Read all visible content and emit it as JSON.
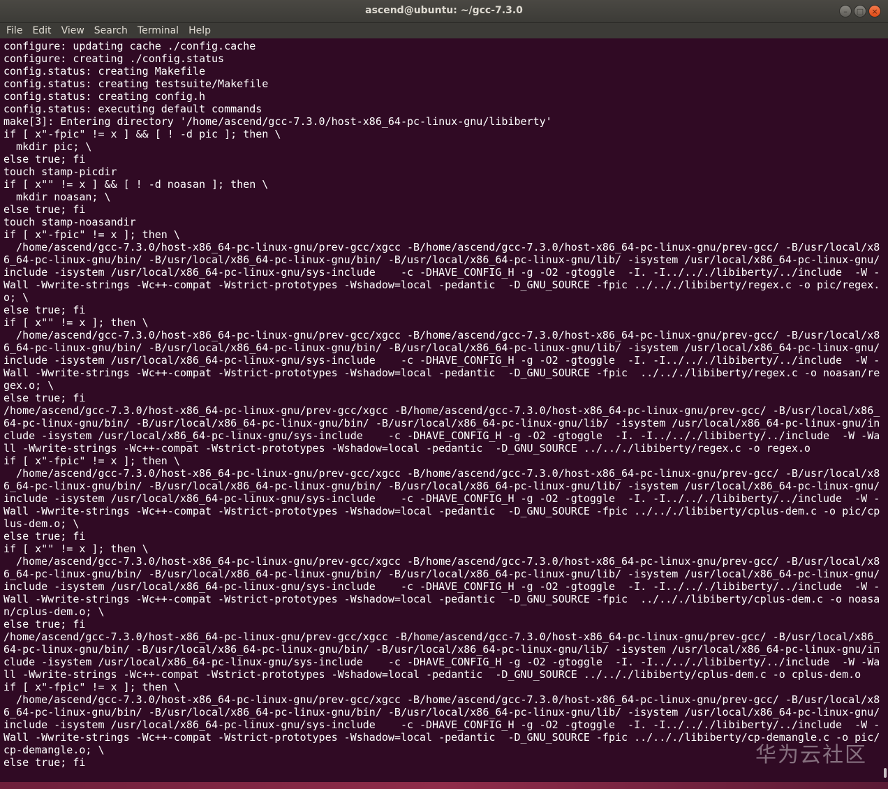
{
  "window": {
    "title": "ascend@ubuntu: ~/gcc-7.3.0",
    "minimize_glyph": "–",
    "maximize_glyph": "□",
    "close_glyph": "×"
  },
  "menubar": {
    "items": [
      "File",
      "Edit",
      "View",
      "Search",
      "Terminal",
      "Help"
    ]
  },
  "terminal": {
    "background": "#300a24",
    "foreground": "#ffffff",
    "output": "configure: updating cache ./config.cache\nconfigure: creating ./config.status\nconfig.status: creating Makefile\nconfig.status: creating testsuite/Makefile\nconfig.status: creating config.h\nconfig.status: executing default commands\nmake[3]: Entering directory '/home/ascend/gcc-7.3.0/host-x86_64-pc-linux-gnu/libiberty'\nif [ x\"-fpic\" != x ] && [ ! -d pic ]; then \\\n  mkdir pic; \\\nelse true; fi\ntouch stamp-picdir\nif [ x\"\" != x ] && [ ! -d noasan ]; then \\\n  mkdir noasan; \\\nelse true; fi\ntouch stamp-noasandir\nif [ x\"-fpic\" != x ]; then \\\n  /home/ascend/gcc-7.3.0/host-x86_64-pc-linux-gnu/prev-gcc/xgcc -B/home/ascend/gcc-7.3.0/host-x86_64-pc-linux-gnu/prev-gcc/ -B/usr/local/x8\n6_64-pc-linux-gnu/bin/ -B/usr/local/x86_64-pc-linux-gnu/bin/ -B/usr/local/x86_64-pc-linux-gnu/lib/ -isystem /usr/local/x86_64-pc-linux-gnu/\ninclude -isystem /usr/local/x86_64-pc-linux-gnu/sys-include    -c -DHAVE_CONFIG_H -g -O2 -gtoggle  -I. -I../.././libiberty/../include  -W -\nWall -Wwrite-strings -Wc++-compat -Wstrict-prototypes -Wshadow=local -pedantic  -D_GNU_SOURCE -fpic ../.././libiberty/regex.c -o pic/regex.\no; \\\nelse true; fi\nif [ x\"\" != x ]; then \\\n  /home/ascend/gcc-7.3.0/host-x86_64-pc-linux-gnu/prev-gcc/xgcc -B/home/ascend/gcc-7.3.0/host-x86_64-pc-linux-gnu/prev-gcc/ -B/usr/local/x8\n6_64-pc-linux-gnu/bin/ -B/usr/local/x86_64-pc-linux-gnu/bin/ -B/usr/local/x86_64-pc-linux-gnu/lib/ -isystem /usr/local/x86_64-pc-linux-gnu/\ninclude -isystem /usr/local/x86_64-pc-linux-gnu/sys-include    -c -DHAVE_CONFIG_H -g -O2 -gtoggle  -I. -I../.././libiberty/../include  -W -\nWall -Wwrite-strings -Wc++-compat -Wstrict-prototypes -Wshadow=local -pedantic  -D_GNU_SOURCE -fpic  ../.././libiberty/regex.c -o noasan/re\ngex.o; \\\nelse true; fi\n/home/ascend/gcc-7.3.0/host-x86_64-pc-linux-gnu/prev-gcc/xgcc -B/home/ascend/gcc-7.3.0/host-x86_64-pc-linux-gnu/prev-gcc/ -B/usr/local/x86_\n64-pc-linux-gnu/bin/ -B/usr/local/x86_64-pc-linux-gnu/bin/ -B/usr/local/x86_64-pc-linux-gnu/lib/ -isystem /usr/local/x86_64-pc-linux-gnu/in\nclude -isystem /usr/local/x86_64-pc-linux-gnu/sys-include    -c -DHAVE_CONFIG_H -g -O2 -gtoggle  -I. -I../.././libiberty/../include  -W -Wa\nll -Wwrite-strings -Wc++-compat -Wstrict-prototypes -Wshadow=local -pedantic  -D_GNU_SOURCE ../.././libiberty/regex.c -o regex.o\nif [ x\"-fpic\" != x ]; then \\\n  /home/ascend/gcc-7.3.0/host-x86_64-pc-linux-gnu/prev-gcc/xgcc -B/home/ascend/gcc-7.3.0/host-x86_64-pc-linux-gnu/prev-gcc/ -B/usr/local/x8\n6_64-pc-linux-gnu/bin/ -B/usr/local/x86_64-pc-linux-gnu/bin/ -B/usr/local/x86_64-pc-linux-gnu/lib/ -isystem /usr/local/x86_64-pc-linux-gnu/\ninclude -isystem /usr/local/x86_64-pc-linux-gnu/sys-include    -c -DHAVE_CONFIG_H -g -O2 -gtoggle  -I. -I../.././libiberty/../include  -W -\nWall -Wwrite-strings -Wc++-compat -Wstrict-prototypes -Wshadow=local -pedantic  -D_GNU_SOURCE -fpic ../.././libiberty/cplus-dem.c -o pic/cp\nlus-dem.o; \\\nelse true; fi\nif [ x\"\" != x ]; then \\\n  /home/ascend/gcc-7.3.0/host-x86_64-pc-linux-gnu/prev-gcc/xgcc -B/home/ascend/gcc-7.3.0/host-x86_64-pc-linux-gnu/prev-gcc/ -B/usr/local/x8\n6_64-pc-linux-gnu/bin/ -B/usr/local/x86_64-pc-linux-gnu/bin/ -B/usr/local/x86_64-pc-linux-gnu/lib/ -isystem /usr/local/x86_64-pc-linux-gnu/\ninclude -isystem /usr/local/x86_64-pc-linux-gnu/sys-include    -c -DHAVE_CONFIG_H -g -O2 -gtoggle  -I. -I../.././libiberty/../include  -W -\nWall -Wwrite-strings -Wc++-compat -Wstrict-prototypes -Wshadow=local -pedantic  -D_GNU_SOURCE -fpic  ../.././libiberty/cplus-dem.c -o noasa\nn/cplus-dem.o; \\\nelse true; fi\n/home/ascend/gcc-7.3.0/host-x86_64-pc-linux-gnu/prev-gcc/xgcc -B/home/ascend/gcc-7.3.0/host-x86_64-pc-linux-gnu/prev-gcc/ -B/usr/local/x86_\n64-pc-linux-gnu/bin/ -B/usr/local/x86_64-pc-linux-gnu/bin/ -B/usr/local/x86_64-pc-linux-gnu/lib/ -isystem /usr/local/x86_64-pc-linux-gnu/in\nclude -isystem /usr/local/x86_64-pc-linux-gnu/sys-include    -c -DHAVE_CONFIG_H -g -O2 -gtoggle  -I. -I../.././libiberty/../include  -W -Wa\nll -Wwrite-strings -Wc++-compat -Wstrict-prototypes -Wshadow=local -pedantic  -D_GNU_SOURCE ../.././libiberty/cplus-dem.c -o cplus-dem.o\nif [ x\"-fpic\" != x ]; then \\\n  /home/ascend/gcc-7.3.0/host-x86_64-pc-linux-gnu/prev-gcc/xgcc -B/home/ascend/gcc-7.3.0/host-x86_64-pc-linux-gnu/prev-gcc/ -B/usr/local/x8\n6_64-pc-linux-gnu/bin/ -B/usr/local/x86_64-pc-linux-gnu/bin/ -B/usr/local/x86_64-pc-linux-gnu/lib/ -isystem /usr/local/x86_64-pc-linux-gnu/\ninclude -isystem /usr/local/x86_64-pc-linux-gnu/sys-include    -c -DHAVE_CONFIG_H -g -O2 -gtoggle  -I. -I../.././libiberty/../include  -W -\nWall -Wwrite-strings -Wc++-compat -Wstrict-prototypes -Wshadow=local -pedantic  -D_GNU_SOURCE -fpic ../.././libiberty/cp-demangle.c -o pic/\ncp-demangle.o; \\\nelse true; fi"
  },
  "watermark": {
    "text": "华为云社区"
  }
}
